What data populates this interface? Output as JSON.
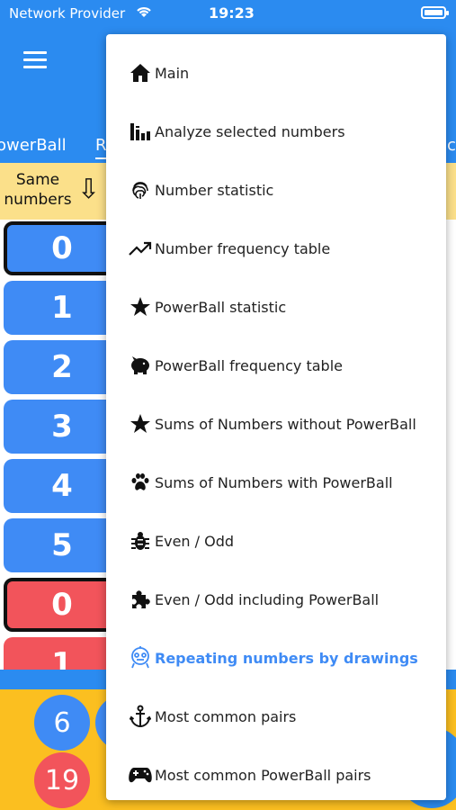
{
  "status": {
    "carrier": "Network Provider",
    "time": "19:23"
  },
  "tabs": {
    "left": "owerBall",
    "middle": "R",
    "right": "c"
  },
  "header": {
    "same_line1": "Same",
    "same_line2": "numbers"
  },
  "numbers": [
    {
      "value": "0",
      "color": "#3f8bf5"
    },
    {
      "value": "1",
      "color": "#3f8bf5"
    },
    {
      "value": "2",
      "color": "#3f8bf5"
    },
    {
      "value": "3",
      "color": "#3f8bf5"
    },
    {
      "value": "4",
      "color": "#3f8bf5"
    },
    {
      "value": "5",
      "color": "#3f8bf5"
    },
    {
      "value": "0",
      "color": "#f2545b"
    },
    {
      "value": "1",
      "color": "#f2545b"
    }
  ],
  "bottom_balls": {
    "first": "6",
    "second": "19"
  },
  "menu": {
    "items": [
      {
        "label": "Main",
        "icon": "home-icon"
      },
      {
        "label": "Analyze selected numbers",
        "icon": "bar-chart-icon"
      },
      {
        "label": "Number statistic",
        "icon": "fingerprint-icon"
      },
      {
        "label": "Number frequency table",
        "icon": "trending-up-icon"
      },
      {
        "label": "PowerBall statistic",
        "icon": "star-icon"
      },
      {
        "label": "PowerBall frequency table",
        "icon": "piggy-bank-icon"
      },
      {
        "label": "Sums of Numbers without PowerBall",
        "icon": "star-icon"
      },
      {
        "label": "Sums of Numbers with PowerBall",
        "icon": "paw-icon"
      },
      {
        "label": "Even / Odd",
        "icon": "bug-icon"
      },
      {
        "label": "Even / Odd including PowerBall",
        "icon": "puzzle-icon"
      },
      {
        "label": "Repeating numbers by drawings",
        "icon": "robot-icon",
        "active": true
      },
      {
        "label": "Most common pairs",
        "icon": "anchor-icon"
      },
      {
        "label": "Most common PowerBall pairs",
        "icon": "gamepad-icon"
      }
    ]
  },
  "colors": {
    "primary": "#2b8bf0",
    "accent_yellow": "#fbbf20",
    "header_yellow": "#fbe08a",
    "active_menu": "#3f8bf5"
  }
}
